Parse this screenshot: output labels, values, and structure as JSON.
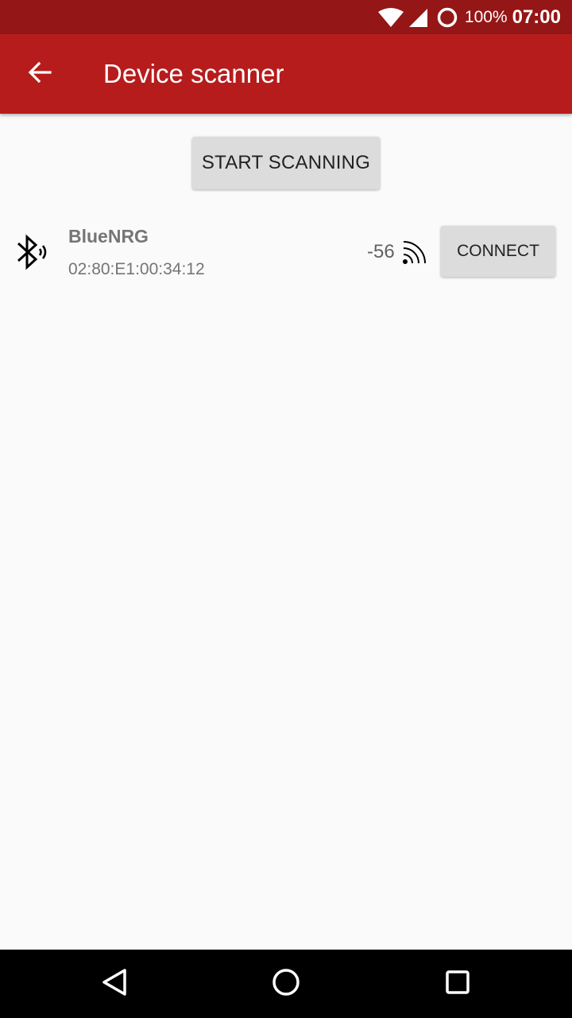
{
  "status_bar": {
    "battery_percent": "100%",
    "time": "07:00",
    "icons": [
      "wifi-icon",
      "cell-signal-icon",
      "battery-ring-icon"
    ]
  },
  "app_bar": {
    "title": "Device scanner",
    "back_icon": "arrow-back-icon",
    "background_color": "#b71c1c",
    "status_color": "#951616"
  },
  "actions": {
    "scan_button_label": "START SCANNING"
  },
  "devices": [
    {
      "name": "BlueNRG",
      "address": "02:80:E1:00:34:12",
      "rssi": "-56",
      "icon": "bluetooth-searching-icon",
      "signal_icon": "rss-signal-icon",
      "connect_label": "CONNECT"
    }
  ],
  "nav_bar": {
    "icons": [
      "back-triangle-icon",
      "home-circle-icon",
      "recents-square-icon"
    ]
  }
}
